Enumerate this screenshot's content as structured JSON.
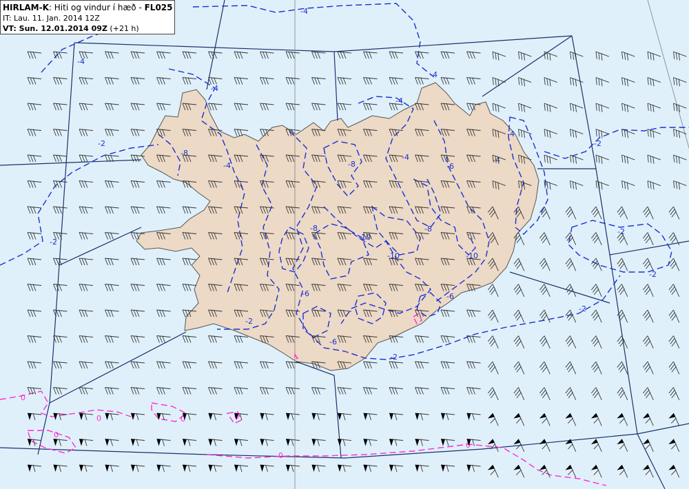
{
  "header": {
    "model": "HIRLAM-K",
    "description": ": Hiti og vindur í hæð - ",
    "level": "FL025",
    "init_time": "IT: Lau. 11. Jan. 2014 12Z",
    "valid_prefix": "VT: Sun. 12.01.2014 09Z",
    "valid_suffix": " (+21 h)"
  },
  "contour_labels": {
    "blue": [
      "-4",
      "-4",
      "-4",
      "-4",
      "-4",
      "-4",
      "-4",
      "-4",
      "-4",
      "-2",
      "-2",
      "-2",
      "-2",
      "-2",
      "-2",
      "-2",
      "-2",
      "-6",
      "-6",
      "-6",
      "-6",
      "-8",
      "-8",
      "-8",
      "-8",
      "-10",
      "-10",
      "-10"
    ],
    "magenta": [
      "0",
      "0",
      "0",
      "0",
      "0",
      "0",
      "0"
    ]
  },
  "colors": {
    "sea": "#dff0fa",
    "land": "#ecd9c6",
    "land_outline": "#555555",
    "sector_lines": "#1a2f6b",
    "meridian": "#8a8a8a",
    "negative_isotherm": "#1a2fd0",
    "zero_isotherm": "#ff2ad6",
    "wind_barbs": "#333333"
  },
  "icons": {
    "wind": "wind-barb-icon"
  }
}
